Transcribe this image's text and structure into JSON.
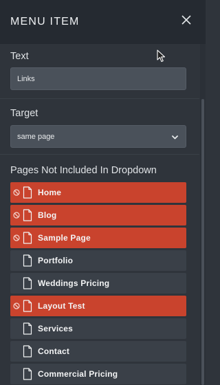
{
  "header": {
    "title": "MENU ITEM"
  },
  "text_field": {
    "label": "Text",
    "value": "Links"
  },
  "target_field": {
    "label": "Target",
    "value": "same page"
  },
  "pages": {
    "label": "Pages Not Included In Dropdown",
    "items": [
      {
        "label": "Home",
        "excluded": true
      },
      {
        "label": "Blog",
        "excluded": true
      },
      {
        "label": "Sample Page",
        "excluded": true
      },
      {
        "label": "Portfolio",
        "excluded": false
      },
      {
        "label": "Weddings Pricing",
        "excluded": false
      },
      {
        "label": "Layout Test",
        "excluded": true
      },
      {
        "label": "Services",
        "excluded": false
      },
      {
        "label": "Contact",
        "excluded": false
      },
      {
        "label": "Commercial Pricing",
        "excluded": false
      }
    ]
  },
  "colors": {
    "excluded": "#c9432d",
    "item": "#3a4048",
    "panel": "#2f343b",
    "header": "#252a31"
  },
  "icons": {
    "close": "close-icon",
    "page": "page-icon",
    "excluded": "ban-icon",
    "dropdown": "chevron-down-icon",
    "cursor": "mouse-cursor-icon"
  }
}
